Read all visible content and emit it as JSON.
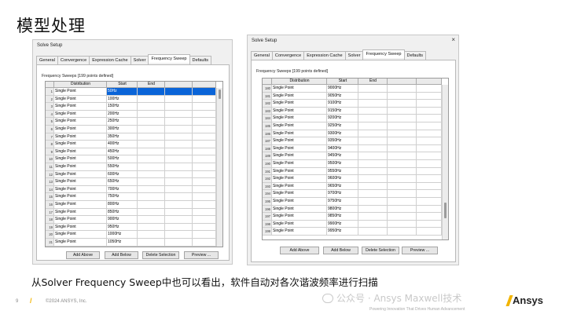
{
  "slide": {
    "title": "模型处理",
    "caption": "从Solver Frequency Sweep中也可以看出，软件自动对各次谐波频率进行扫描",
    "page_number": "9",
    "copyright": "©2024 ANSYS, Inc.",
    "tagline": "Powering Innovation That Drives Human Advancement",
    "watermark": "公众号 · Ansys Maxwell技术",
    "brand": "Ansys",
    "accent_color": "#f2b400"
  },
  "dialog_left": {
    "title": "Solve Setup",
    "tabs": [
      "General",
      "Convergence",
      "Expression Cache",
      "Solver",
      "Frequency Sweep",
      "Defaults"
    ],
    "active_tab": "Frequency Sweep",
    "sweeps_label": "Frequency Sweeps [199 points defined]",
    "columns": [
      "Distribution",
      "Start",
      "End"
    ],
    "selected_row": 1,
    "rows": [
      {
        "n": "1",
        "dist": "Single Point",
        "start": "50Hz"
      },
      {
        "n": "2",
        "dist": "Single Point",
        "start": "100Hz"
      },
      {
        "n": "3",
        "dist": "Single Point",
        "start": "150Hz"
      },
      {
        "n": "4",
        "dist": "Single Point",
        "start": "200Hz"
      },
      {
        "n": "5",
        "dist": "Single Point",
        "start": "250Hz"
      },
      {
        "n": "6",
        "dist": "Single Point",
        "start": "300Hz"
      },
      {
        "n": "7",
        "dist": "Single Point",
        "start": "350Hz"
      },
      {
        "n": "8",
        "dist": "Single Point",
        "start": "400Hz"
      },
      {
        "n": "9",
        "dist": "Single Point",
        "start": "450Hz"
      },
      {
        "n": "10",
        "dist": "Single Point",
        "start": "500Hz"
      },
      {
        "n": "11",
        "dist": "Single Point",
        "start": "550Hz"
      },
      {
        "n": "12",
        "dist": "Single Point",
        "start": "600Hz"
      },
      {
        "n": "13",
        "dist": "Single Point",
        "start": "650Hz"
      },
      {
        "n": "14",
        "dist": "Single Point",
        "start": "700Hz"
      },
      {
        "n": "15",
        "dist": "Single Point",
        "start": "750Hz"
      },
      {
        "n": "16",
        "dist": "Single Point",
        "start": "800Hz"
      },
      {
        "n": "17",
        "dist": "Single Point",
        "start": "850Hz"
      },
      {
        "n": "18",
        "dist": "Single Point",
        "start": "900Hz"
      },
      {
        "n": "19",
        "dist": "Single Point",
        "start": "950Hz"
      },
      {
        "n": "20",
        "dist": "Single Point",
        "start": "1000Hz"
      },
      {
        "n": "21",
        "dist": "Single Point",
        "start": "1050Hz"
      }
    ],
    "buttons": [
      "Add Above",
      "Add Below",
      "Delete Selection",
      "Preview ..."
    ]
  },
  "dialog_right": {
    "title": "Solve Setup",
    "tabs": [
      "General",
      "Convergence",
      "Expression Cache",
      "Solver",
      "Frequency Sweep",
      "Defaults"
    ],
    "active_tab": "Frequency Sweep",
    "sweeps_label": "Frequency Sweeps [199 points defined]",
    "columns": [
      "Distribution",
      "Start",
      "End"
    ],
    "selected_row": 0,
    "rows": [
      {
        "n": "180",
        "dist": "Single Point",
        "start": "9000Hz"
      },
      {
        "n": "181",
        "dist": "Single Point",
        "start": "9050Hz"
      },
      {
        "n": "182",
        "dist": "Single Point",
        "start": "9100Hz"
      },
      {
        "n": "183",
        "dist": "Single Point",
        "start": "9150Hz"
      },
      {
        "n": "184",
        "dist": "Single Point",
        "start": "9200Hz"
      },
      {
        "n": "185",
        "dist": "Single Point",
        "start": "9250Hz"
      },
      {
        "n": "186",
        "dist": "Single Point",
        "start": "9300Hz"
      },
      {
        "n": "187",
        "dist": "Single Point",
        "start": "9350Hz"
      },
      {
        "n": "188",
        "dist": "Single Point",
        "start": "9400Hz"
      },
      {
        "n": "189",
        "dist": "Single Point",
        "start": "9450Hz"
      },
      {
        "n": "190",
        "dist": "Single Point",
        "start": "9500Hz"
      },
      {
        "n": "191",
        "dist": "Single Point",
        "start": "9550Hz"
      },
      {
        "n": "192",
        "dist": "Single Point",
        "start": "9600Hz"
      },
      {
        "n": "193",
        "dist": "Single Point",
        "start": "9650Hz"
      },
      {
        "n": "194",
        "dist": "Single Point",
        "start": "9700Hz"
      },
      {
        "n": "195",
        "dist": "Single Point",
        "start": "9750Hz"
      },
      {
        "n": "196",
        "dist": "Single Point",
        "start": "9800Hz"
      },
      {
        "n": "197",
        "dist": "Single Point",
        "start": "9850Hz"
      },
      {
        "n": "198",
        "dist": "Single Point",
        "start": "9900Hz"
      },
      {
        "n": "199",
        "dist": "Single Point",
        "start": "9950Hz"
      }
    ],
    "buttons": [
      "Add Above",
      "Add Below",
      "Delete Selection",
      "Preview ..."
    ]
  }
}
